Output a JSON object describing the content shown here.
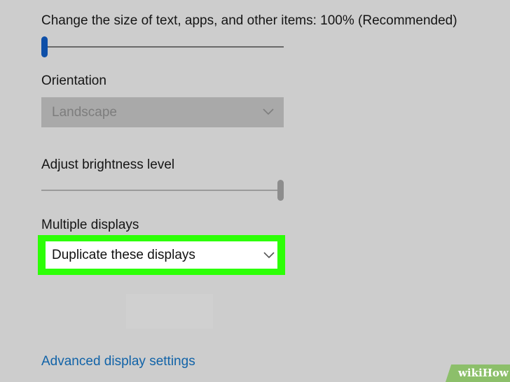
{
  "scale": {
    "label": "Change the size of text, apps, and other items: 100% (Recommended)",
    "value_fraction": 0.0
  },
  "orientation": {
    "label": "Orientation",
    "selected": "Landscape",
    "disabled": true
  },
  "brightness": {
    "label": "Adjust brightness level",
    "value_fraction": 1.0
  },
  "multiple_displays": {
    "label": "Multiple displays",
    "selected": "Duplicate these displays"
  },
  "advanced_link": "Advanced display settings",
  "watermark": "wikiHow",
  "colors": {
    "accent": "#0e4fa8",
    "highlight": "#2cff06",
    "link": "#1163a8",
    "background": "#cdcdcd",
    "watermark_bg": "#8cbf6a"
  },
  "icons": {
    "dropdown": "chevron-down-icon"
  }
}
